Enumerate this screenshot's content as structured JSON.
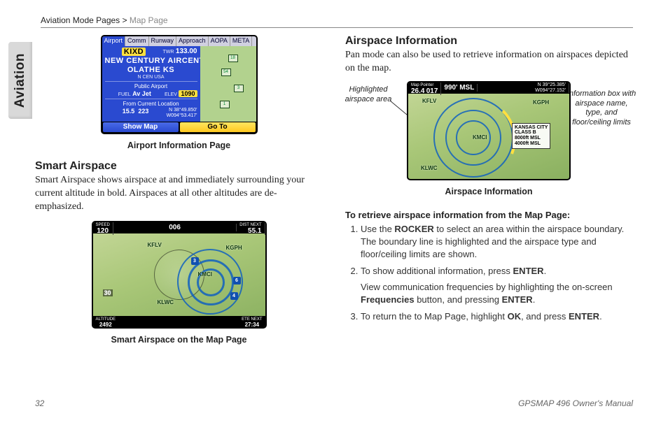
{
  "breadcrumb": {
    "section": "Aviation Mode Pages",
    "separator": " > ",
    "page": "Map Page"
  },
  "side_tab": "Aviation",
  "left": {
    "fig1": {
      "tabs": [
        "Airport",
        "Comm",
        "Runway",
        "Approach",
        "AOPA",
        "META"
      ],
      "ident": "KIXD",
      "twr_lbl": "TWR",
      "twr_val": "133.00",
      "name1": "NEW CENTURY AIRCENTER",
      "name2": "OLATHE KS",
      "region": "N CEN USA",
      "type_lbl": "Public Airport",
      "fuel_lbl": "FUEL",
      "fuel_val": "Av Jet",
      "elev_lbl": "ELEV",
      "elev_val": "1090",
      "from_lbl": "From Current Location",
      "dist": "15.5",
      "brg": "223",
      "lat": "N 38°49.850'",
      "lon": "W094°53.417'",
      "btn_showmap": "Show Map",
      "btn_goto": "Go To",
      "wp": [
        "18",
        "54",
        "3",
        "1"
      ],
      "caption": "Airport Information Page"
    },
    "smart_heading": "Smart Airspace",
    "smart_body": "Smart Airspace shows airspace at and immediately surrounding your current altitude in bold. Airspaces at all other altitudes are de-emphasized.",
    "fig2": {
      "top_speed_lbl": "SPEED",
      "top_speed": "120",
      "top_hdg": "006",
      "top_dist_lbl": "DIST NEXT",
      "top_dist": "55.1",
      "bot_alt_lbl": "ALTITUDE",
      "bot_alt": "2492",
      "bot_ete_lbl": "ETE NEXT",
      "bot_ete": "27:34",
      "scale": "30",
      "pts": [
        "KFLV",
        "KGPH",
        "KLWC",
        "KMCI"
      ],
      "hwy": [
        "3",
        "6",
        "4"
      ],
      "caption": "Smart Airspace on the Map Page"
    }
  },
  "right": {
    "h": "Airspace Information",
    "p": "Pan mode can also be used to retrieve information on airspaces depicted on the map.",
    "lbl_left": "Highlighted airspace area",
    "lbl_right": "Information box with airspace name, type, and floor/ceiling limits",
    "fig3": {
      "top_l1_lbl": "Map Pointer",
      "top_l1": "26.4",
      "top_l1b": "017",
      "top_mid": "990' MSL",
      "top_r1": "N 39°25.385'",
      "top_r2": "W094°27.152'",
      "info_name": "KANSAS CITY",
      "info_class": "CLASS B",
      "info_ceil": "8000ft MSL",
      "info_floor": "4000ft MSL",
      "pts": [
        "KFLV",
        "KGPH",
        "KMCI",
        "KLWC"
      ],
      "caption": "Airspace Information"
    },
    "instr_head": "To retrieve airspace information from the Map Page:",
    "steps": {
      "s1a": "Use the ",
      "s1b": "ROCKER",
      "s1c": " to select an area within the airspace boundary. The boundary line is highlighted and the airspace type and floor/ceiling limits are shown.",
      "s2a": "To show additional information, press ",
      "s2b": "ENTER",
      "s2c": ".",
      "s2sub_a": "View communication frequencies by highlighting the on-screen ",
      "s2sub_b": "Frequencies",
      "s2sub_c": " button, and pressing ",
      "s2sub_d": "ENTER",
      "s2sub_e": ".",
      "s3a": "To return the to Map Page, highlight ",
      "s3b": "OK",
      "s3c": ", and press ",
      "s3d": "ENTER",
      "s3e": "."
    }
  },
  "page_number": "32",
  "manual_title": "GPSMAP 496 Owner's Manual"
}
